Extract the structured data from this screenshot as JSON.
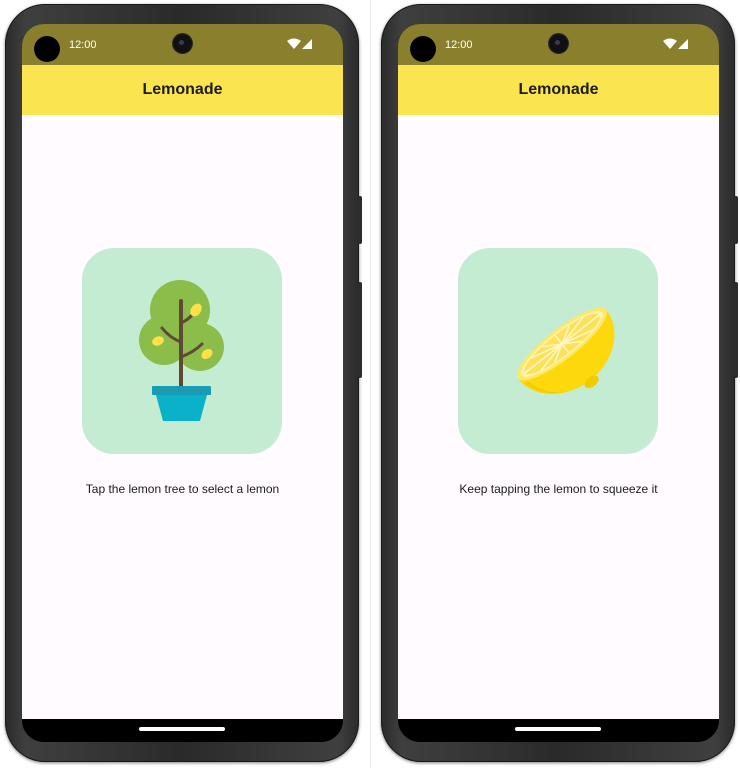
{
  "screens": [
    {
      "status": {
        "time": "12:00"
      },
      "app_bar": {
        "title": "Lemonade"
      },
      "image_button": {
        "icon": "lemon-tree-icon"
      },
      "instruction": "Tap the lemon tree to select a lemon"
    },
    {
      "status": {
        "time": "12:00"
      },
      "app_bar": {
        "title": "Lemonade"
      },
      "image_button": {
        "icon": "lemon-squeeze-icon"
      },
      "instruction": "Keep tapping the lemon to squeeze it"
    }
  ],
  "colors": {
    "status_bar": "#8a7f2c",
    "app_bar": "#fae44f",
    "background": "#fffbfe",
    "image_button_bg": "#c3ecd2",
    "text": "#1c1b1f"
  }
}
